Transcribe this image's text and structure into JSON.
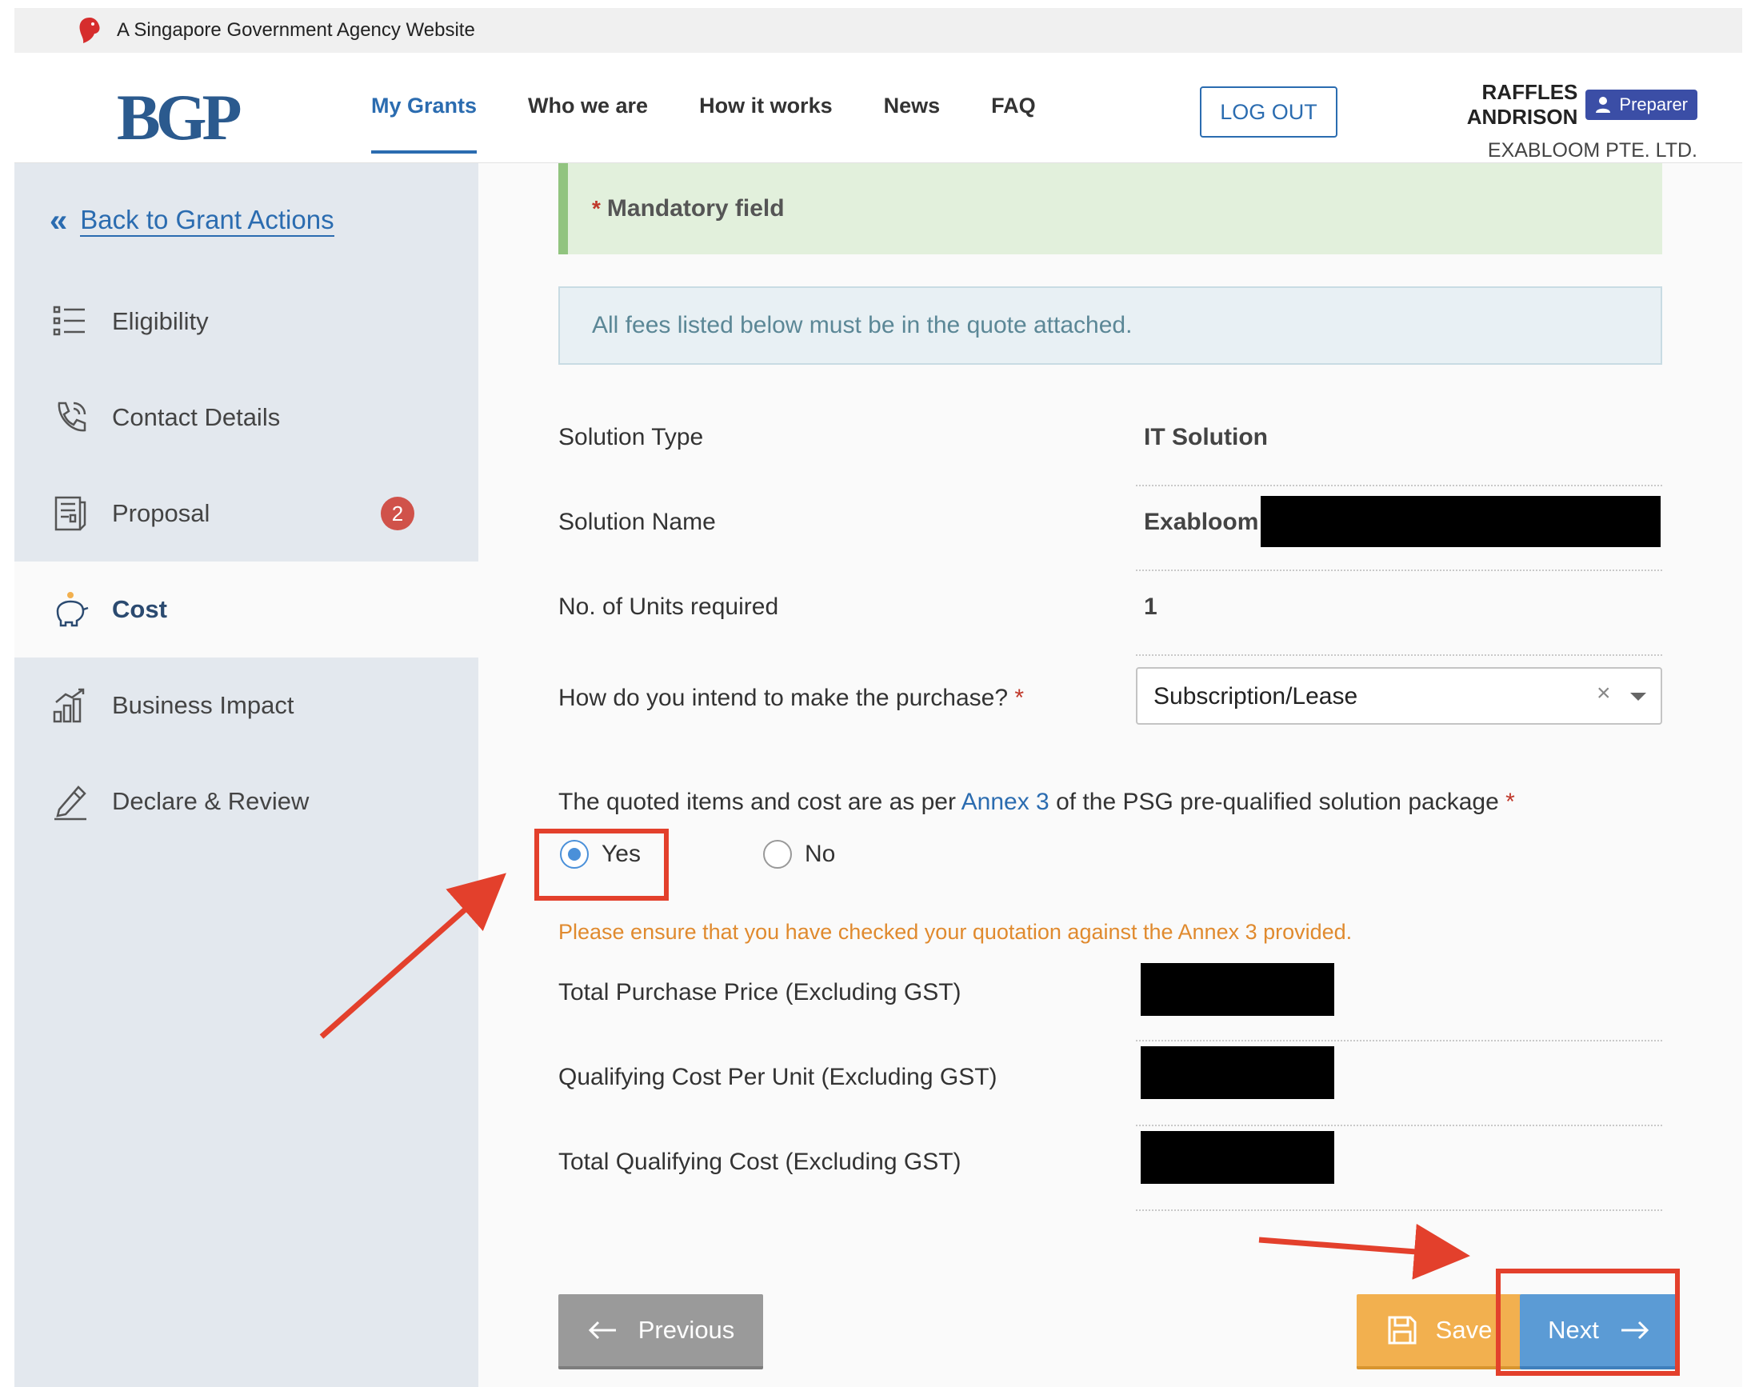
{
  "masthead": {
    "text": "A Singapore Government Agency Website"
  },
  "header": {
    "logo": "BGP",
    "nav": [
      {
        "label": "My Grants",
        "active": true
      },
      {
        "label": "Who we are",
        "active": false
      },
      {
        "label": "How it works",
        "active": false
      },
      {
        "label": "News",
        "active": false
      },
      {
        "label": "FAQ",
        "active": false
      }
    ],
    "logout_label": "LOG OUT",
    "user": {
      "name": "RAFFLES ANDRISON",
      "role": "Preparer",
      "company": "EXABLOOM PTE. LTD."
    }
  },
  "sidebar": {
    "back_label": "Back to Grant Actions",
    "items": [
      {
        "label": "Eligibility",
        "icon": "list-icon"
      },
      {
        "label": "Contact Details",
        "icon": "phone-icon"
      },
      {
        "label": "Proposal",
        "icon": "document-icon",
        "badge": "2"
      },
      {
        "label": "Cost",
        "icon": "piggy-bank-icon",
        "active": true
      },
      {
        "label": "Business Impact",
        "icon": "bar-chart-icon"
      },
      {
        "label": "Declare & Review",
        "icon": "pen-icon"
      }
    ]
  },
  "form": {
    "mandatory_star": "*",
    "mandatory_text": "Mandatory field",
    "info_text": "All fees listed below must be in the quote attached.",
    "solution_type": {
      "label": "Solution Type",
      "value": "IT Solution"
    },
    "solution_name": {
      "label": "Solution Name",
      "value": "Exabloom"
    },
    "units": {
      "label": "No. of Units required",
      "value": "1"
    },
    "purchase": {
      "label": "How do you intend to make the purchase?",
      "required": "*",
      "value": "Subscription/Lease",
      "clear": "×"
    },
    "question": {
      "before": "The quoted items and cost are as per ",
      "link": "Annex 3",
      "after": " of the PSG pre-qualified solution package",
      "required": "*"
    },
    "radio": {
      "yes": "Yes",
      "no": "No",
      "selected": "Yes"
    },
    "warning": "Please ensure that you have checked your quotation against the Annex 3 provided.",
    "total_purchase": {
      "label": "Total Purchase Price (Excluding GST)"
    },
    "qualifying_per_unit": {
      "label": "Qualifying Cost Per Unit (Excluding GST)"
    },
    "total_qualifying": {
      "label": "Total Qualifying Cost (Excluding GST)"
    }
  },
  "buttons": {
    "previous": "Previous",
    "save": "Save",
    "next": "Next"
  },
  "colors": {
    "primary": "#2b6cb0",
    "sidebar_bg": "#e3e8ee",
    "save": "#f2b04f",
    "next": "#5b9bd5",
    "annotation": "#e3402c"
  }
}
